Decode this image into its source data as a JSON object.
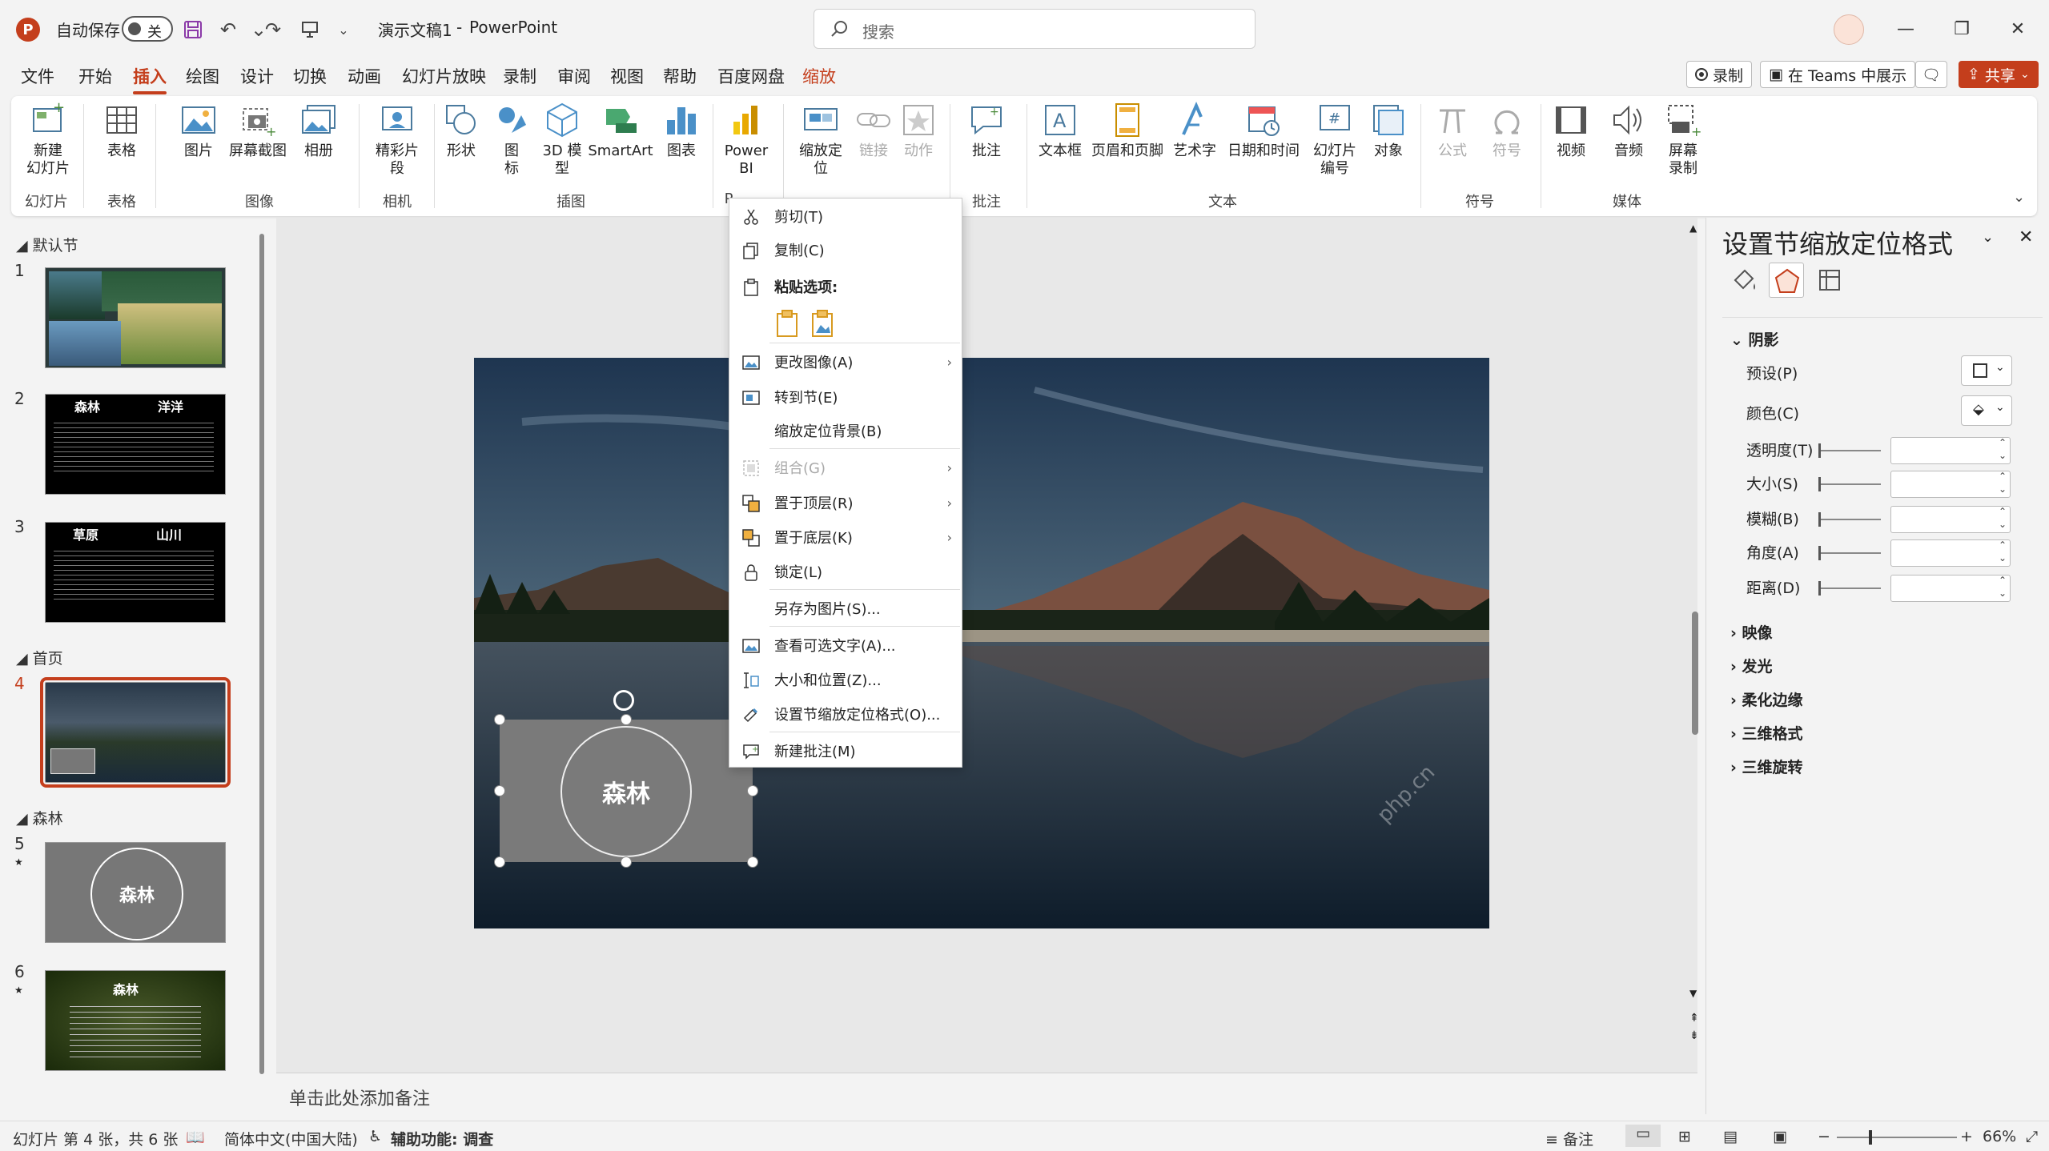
{
  "titlebar": {
    "autosave_label": "自动保存",
    "autosave_state": "关",
    "doc_title": "演示文稿1",
    "separator": "-",
    "app_name": "PowerPoint",
    "search_placeholder": "搜索"
  },
  "menu": {
    "tabs": [
      "文件",
      "开始",
      "插入",
      "绘图",
      "设计",
      "切换",
      "动画",
      "幻灯片放映",
      "录制",
      "审阅",
      "视图",
      "帮助",
      "百度网盘",
      "缩放"
    ],
    "active_tab": "插入",
    "record_button": "录制",
    "teams_button": "在 Teams 中展示",
    "share_button": "共享"
  },
  "ribbon": {
    "items": {
      "new_slide": "新建\n幻灯片",
      "table": "表格",
      "picture": "图片",
      "screenshot": "屏幕截图",
      "album": "相册",
      "cameo": "精彩片\n段",
      "shapes": "形状",
      "icons": "图\n标",
      "model3d": "3D 模\n型",
      "smartart": "SmartArt",
      "chart": "图表",
      "powerbi": "Power\nBI",
      "zoom": "缩放定\n位",
      "link": "链接",
      "action": "动作",
      "comment": "批注",
      "textbox": "文本框",
      "header_footer": "页眉和页脚",
      "wordart": "艺术字",
      "datetime": "日期和时间",
      "slide_number": "幻灯片\n编号",
      "object": "对象",
      "equation": "公式",
      "symbol": "符号",
      "video": "视频",
      "audio": "音频",
      "screen_recording": "屏幕\n录制"
    },
    "groups": {
      "slides": "幻灯片",
      "tables": "表格",
      "images": "图像",
      "camera": "相机",
      "illustrations": "插图",
      "powerbi": "P",
      "comments": "批注",
      "text": "文本",
      "symbols": "符号",
      "media": "媒体"
    }
  },
  "slides_panel": {
    "sections": [
      "默认节",
      "首页",
      "森林"
    ],
    "slide_numbers": [
      "1",
      "2",
      "3",
      "4",
      "5",
      "6"
    ],
    "thumb2": {
      "left": "森林",
      "right": "洋洋"
    },
    "thumb3": {
      "left": "草原",
      "right": "山川"
    },
    "thumb5": "森林",
    "thumb6": "森林",
    "selected_slide": "4"
  },
  "slide": {
    "zoom_label": "森林",
    "watermark": "php.cn"
  },
  "notes_placeholder": "单击此处添加备注",
  "context_menu": {
    "items": [
      {
        "label": "剪切(T)",
        "icon": "scissors-icon"
      },
      {
        "label": "复制(C)",
        "icon": "copy-icon"
      },
      {
        "label": "粘贴选项:",
        "icon": "paste-icon"
      },
      {
        "label": "更改图像(A)",
        "icon": "change-image-icon",
        "submenu": true
      },
      {
        "label": "转到节(E)",
        "icon": "goto-section-icon"
      },
      {
        "label": "缩放定位背景(B)",
        "icon": ""
      },
      {
        "label": "组合(G)",
        "icon": "group-icon",
        "submenu": true,
        "disabled": true
      },
      {
        "label": "置于顶层(R)",
        "icon": "bring-front-icon",
        "submenu": true
      },
      {
        "label": "置于底层(K)",
        "icon": "send-back-icon",
        "submenu": true
      },
      {
        "label": "锁定(L)",
        "icon": "lock-icon"
      },
      {
        "label": "另存为图片(S)...",
        "icon": ""
      },
      {
        "label": "查看可选文字(A)...",
        "icon": "alt-text-icon"
      },
      {
        "label": "大小和位置(Z)...",
        "icon": "size-position-icon"
      },
      {
        "label": "设置节缩放定位格式(O)...",
        "icon": "format-zoom-icon"
      },
      {
        "label": "新建批注(M)",
        "icon": "new-comment-icon"
      }
    ]
  },
  "format_pane": {
    "title": "设置节缩放定位格式",
    "shadow": {
      "header": "阴影",
      "preset": "预设(P)",
      "color": "颜色(C)",
      "transparency": "透明度(T)",
      "size": "大小(S)",
      "blur": "模糊(B)",
      "angle": "角度(A)",
      "distance": "距离(D)"
    },
    "collapsed": [
      "映像",
      "发光",
      "柔化边缘",
      "三维格式",
      "三维旋转"
    ]
  },
  "statusbar": {
    "slide_info": "幻灯片 第 4 张，共 6 张",
    "language": "简体中文(中国大陆)",
    "accessibility": "辅助功能: 调查",
    "notes": "备注",
    "zoom": "66%"
  },
  "colors": {
    "accent": "#c43e1c",
    "selection": "#c43e1c"
  }
}
